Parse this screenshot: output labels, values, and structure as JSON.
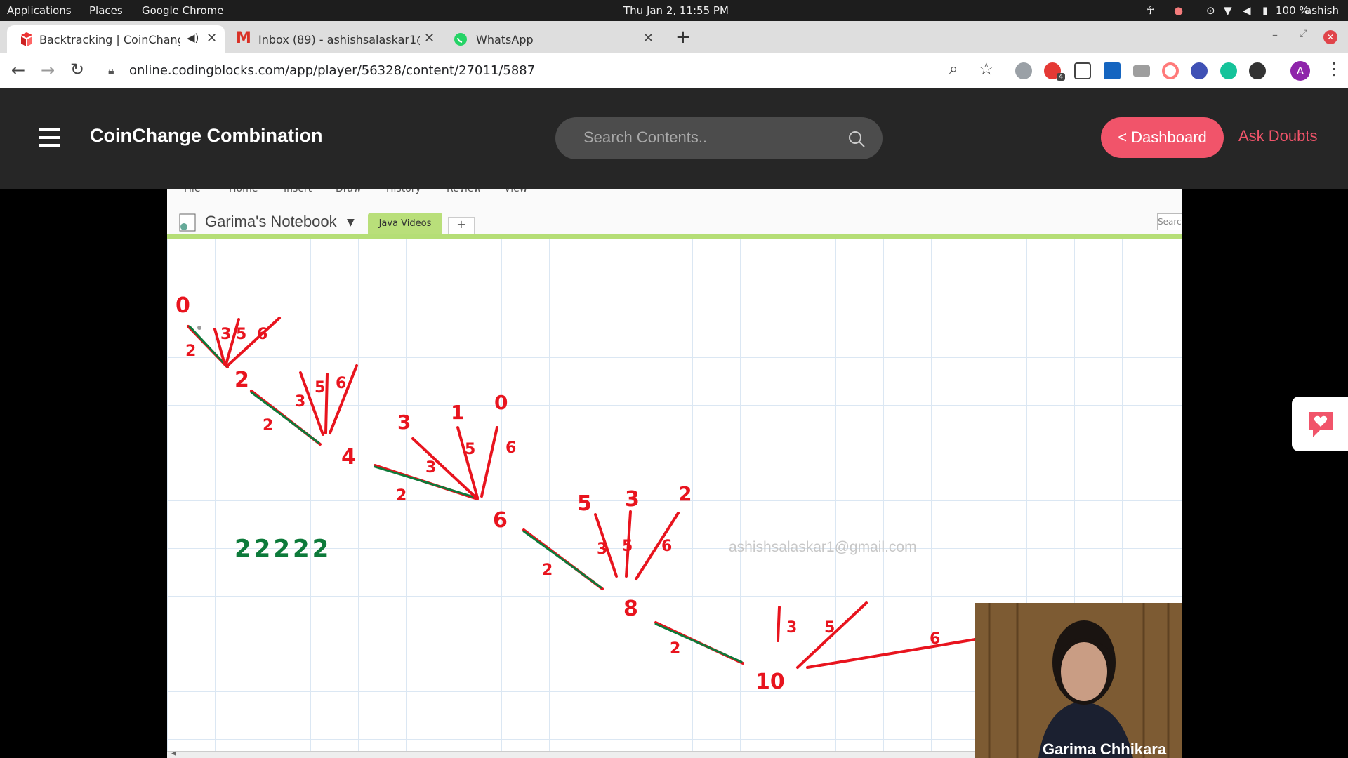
{
  "os": {
    "menu": [
      "Applications",
      "Places",
      "Google Chrome"
    ],
    "clock": "Thu Jan  2, 11:55 PM",
    "battery": "100 %",
    "user": "ashish"
  },
  "tabs": [
    {
      "title": "Backtracking | CoinChang",
      "icon": "codingblocks-icon",
      "audio": true
    },
    {
      "title": "Inbox (89) - ashishsalaskar1@",
      "icon": "gmail-icon"
    },
    {
      "title": "WhatsApp",
      "icon": "whatsapp-icon"
    }
  ],
  "toolbar": {
    "url": "online.codingblocks.com/app/player/56328/content/27011/5887",
    "profile_initial": "A",
    "badge_count": "4"
  },
  "site": {
    "title": "CoinChange Combination",
    "search_placeholder": "Search Contents..",
    "dashboard_label": "< Dashboard",
    "ask_label": "Ask Doubts"
  },
  "notebook": {
    "ribbon": [
      "File",
      "Home",
      "Insert",
      "Draw",
      "History",
      "Review",
      "View"
    ],
    "title": "Garima's Notebook",
    "section_tab": "Java Videos",
    "add_tab": "+",
    "search": "Search"
  },
  "drawing": {
    "nodes": [
      "0",
      "2",
      "4",
      "6",
      "8",
      "10"
    ],
    "green_label": "22222",
    "branch_labels": {
      "n0": [
        "2",
        "3",
        "5",
        "6"
      ],
      "n2": [
        "2",
        "3",
        "5",
        "6"
      ],
      "n4": [
        "2",
        "3",
        "5",
        "6",
        "3",
        "1",
        "0"
      ],
      "n6": [
        "2",
        "3",
        "5",
        "6",
        "5",
        "3",
        "2"
      ],
      "n8": [
        "2",
        "3",
        "5",
        "6"
      ]
    }
  },
  "watermark": "ashishsalaskar1@gmail.com",
  "presenter": "Garima Chhikara",
  "colors": {
    "accent": "#f1546a",
    "header_bg": "#262626",
    "ink_red": "#e8141e",
    "ink_green": "#0d7a3a"
  }
}
